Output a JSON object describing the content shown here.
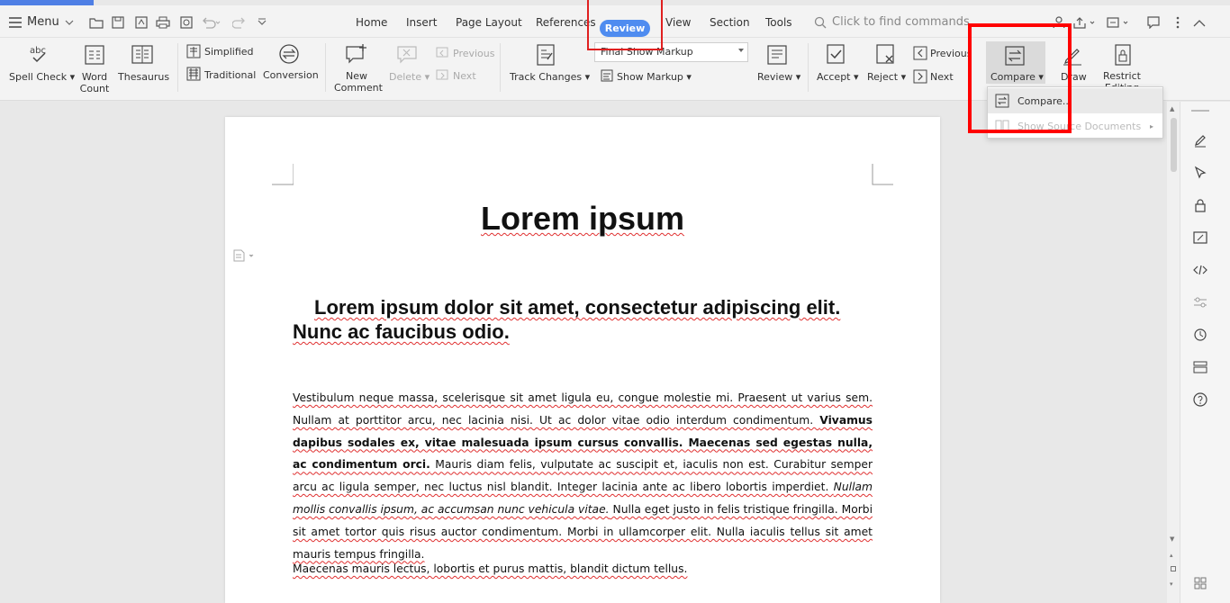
{
  "topbar": {
    "menu_label": "Menu",
    "tabs": [
      {
        "label": "Home"
      },
      {
        "label": "Insert"
      },
      {
        "label": "Page Layout"
      },
      {
        "label": "References"
      },
      {
        "label": "Review"
      },
      {
        "label": "View"
      },
      {
        "label": "Section"
      },
      {
        "label": "Tools"
      }
    ],
    "find_placeholder": "Click to find commands"
  },
  "ribbon": {
    "spell_check": "Spell Check",
    "word_count_1": "Word",
    "word_count_2": "Count",
    "thesaurus": "Thesaurus",
    "simplified": "Simplified",
    "traditional": "Traditional",
    "conversion": "Conversion",
    "new_comment_1": "New",
    "new_comment_2": "Comment",
    "delete": "Delete",
    "previous_comment": "Previous",
    "next_comment": "Next",
    "track_changes": "Track Changes",
    "markup_combo": "Final Show Markup",
    "show_markup": "Show Markup",
    "review": "Review",
    "accept": "Accept",
    "reject": "Reject",
    "previous_change": "Previous",
    "next_change": "Next",
    "compare": "Compare",
    "draw": "Draw",
    "restrict_1": "Restrict",
    "restrict_2": "Editing"
  },
  "compare_menu": {
    "item_compare": "Compare...",
    "item_show_source": "Show Source Documents"
  },
  "document": {
    "title": "Lorem ipsum",
    "heading": "Lorem ipsum dolor sit amet, consectetur adipiscing elit. Nunc ac faucibus odio.",
    "para1_a": "Vestibulum neque massa, scelerisque sit amet ligula eu, congue molestie mi. Praesent ut varius sem. Nullam at porttitor arcu, nec lacinia nisi. Ut ac dolor vitae odio interdum condimentum. ",
    "para1_b": "Vivamus dapibus sodales ex, vitae malesuada ipsum cursus convallis. Maecenas sed egestas nulla, ac condimentum orci.",
    "para1_c": " Mauris diam felis, vulputate ac suscipit et, iaculis non est. Curabitur semper arcu ac ligula semper, nec luctus nisl blandit. Integer lacinia ante ac libero lobortis imperdiet. ",
    "para1_d": "Nullam mollis convallis ipsum, ac accumsan nunc vehicula vitae.",
    "para1_e": " Nulla eget justo in felis tristique fringilla. Morbi sit amet tortor quis risus auctor condimentum. Morbi in ullamcorper elit. Nulla iaculis tellus sit amet mauris tempus fringilla.",
    "para2": "Maecenas mauris lectus, lobortis et purus mattis, blandit dictum tellus."
  },
  "colors": {
    "accent": "#4f8cf0",
    "highlight_red": "#ff0000"
  }
}
